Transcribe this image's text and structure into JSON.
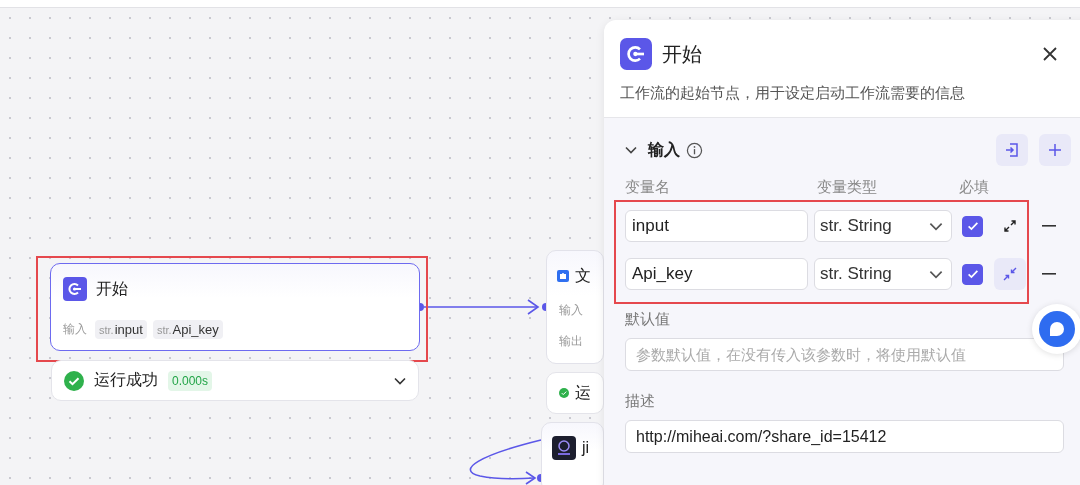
{
  "start_node": {
    "title": "开始",
    "selected": true,
    "input_label": "输入",
    "variables": [
      {
        "type": "str.",
        "name": "input"
      },
      {
        "type": "str.",
        "name": "Api_key"
      }
    ]
  },
  "start_status": {
    "text": "运行成功",
    "time": "0.000s",
    "expanded": false
  },
  "second_node": {
    "title": "文",
    "rows": [
      "输入",
      "输出"
    ]
  },
  "second_status": {
    "text": "运"
  },
  "third_node": {
    "title": "ji"
  },
  "panel": {
    "title": "开始",
    "description": "工作流的起始节点，用于设定启动工作流需要的信息",
    "section": {
      "title": "输入",
      "expanded": true
    },
    "columns": [
      "变量名",
      "变量类型",
      "必填"
    ],
    "variables": [
      {
        "name": "input",
        "type": "str. String",
        "required": true,
        "expanded": false
      },
      {
        "name": "Api_key",
        "type": "str. String",
        "required": true,
        "expanded": true
      }
    ],
    "default_label": "默认值",
    "default_placeholder": "参数默认值，在没有传入该参数时，将使用默认值",
    "description_label": "描述",
    "description_value": "http://miheai.com/?share_id=15412"
  }
}
